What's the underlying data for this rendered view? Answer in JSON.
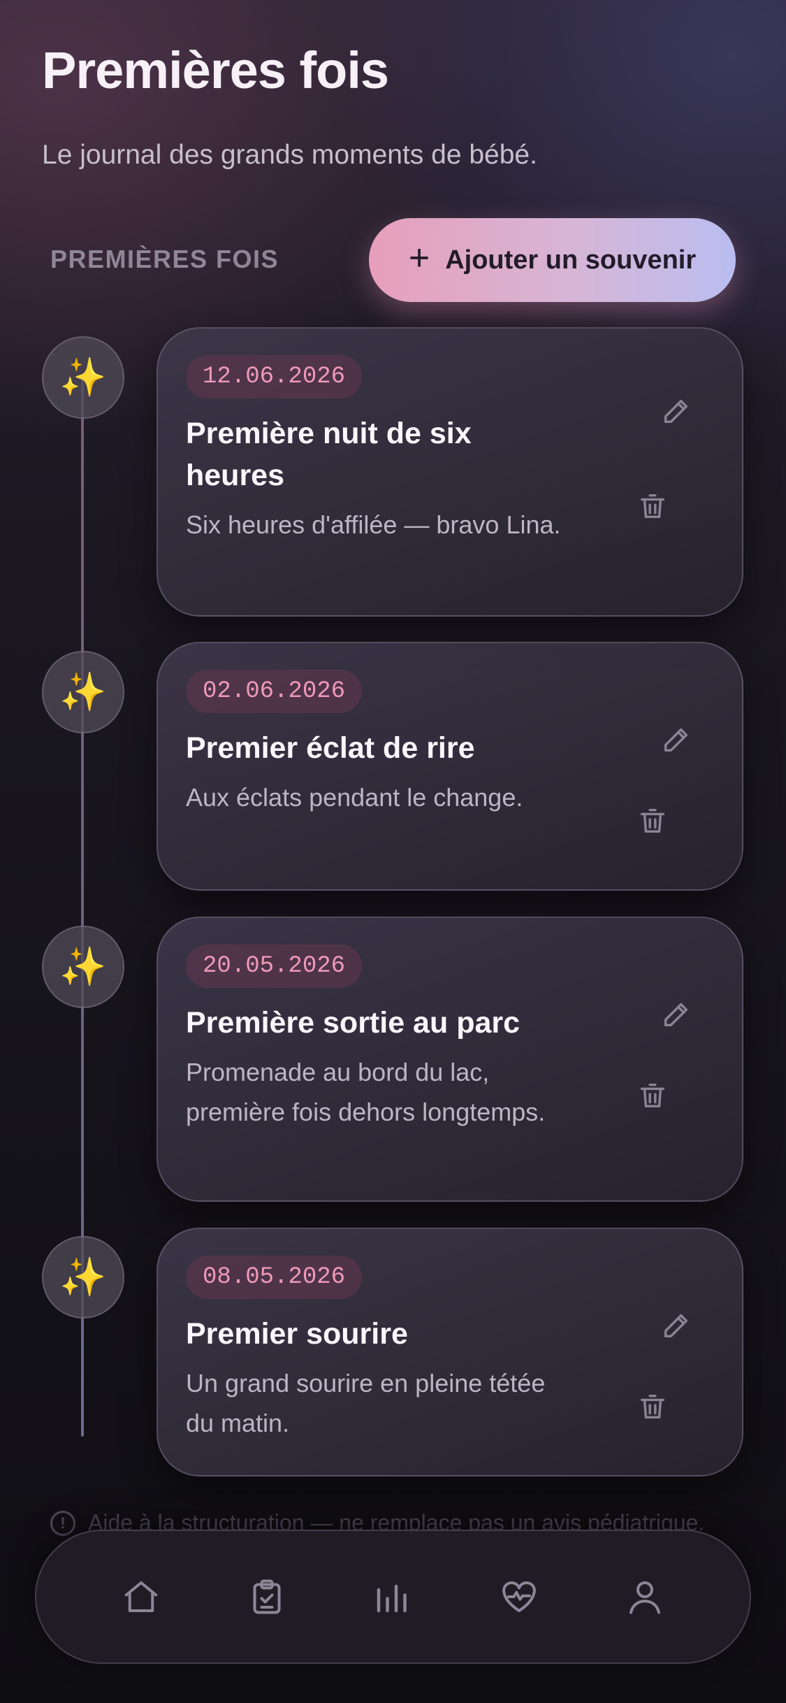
{
  "header": {
    "title": "Premières fois",
    "subtitle": "Le journal des grands moments de bébé."
  },
  "section": {
    "label": "PREMIÈRES FOIS",
    "add_button_label": "Ajouter un souvenir",
    "add_button_icon": "plus-icon"
  },
  "entries": [
    {
      "date": "12.06.2026",
      "title": "Première nuit de six heures",
      "description": "Six heures d'affilée — bravo Lina.",
      "icon": "sparkles-icon"
    },
    {
      "date": "02.06.2026",
      "title": "Premier éclat de rire",
      "description": "Aux éclats pendant le change.",
      "icon": "sparkles-icon"
    },
    {
      "date": "20.05.2026",
      "title": "Première sortie au parc",
      "description": "Promenade au bord du lac, première fois dehors longtemps.",
      "icon": "sparkles-icon"
    },
    {
      "date": "08.05.2026",
      "title": "Premier sourire",
      "description": "Un grand sourire en pleine tétée du matin.",
      "icon": "sparkles-icon"
    }
  ],
  "disclaimer": "Aide à la structuration — ne remplace pas un avis pédiatrique.",
  "nav": {
    "items": [
      "home-icon",
      "clipboard-check-icon",
      "chart-bars-icon",
      "heart-pulse-icon",
      "user-icon"
    ]
  },
  "colors": {
    "accent_pink": "#e79fba",
    "accent_lavender": "#b9bdf0",
    "date_text": "#ef9ab8",
    "sparkle": "#f7c948"
  }
}
